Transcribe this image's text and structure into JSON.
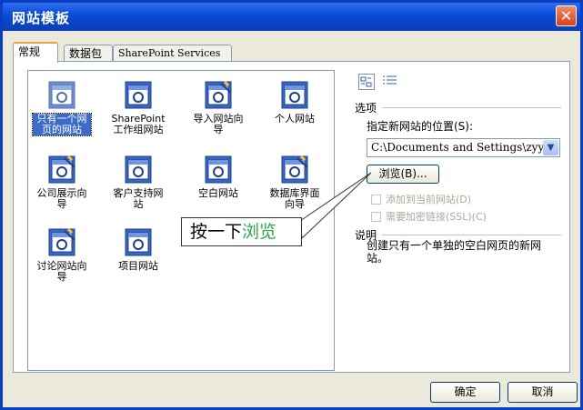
{
  "window": {
    "title": "网站模板",
    "close_glyph": "✕"
  },
  "tabs": [
    {
      "label": "常规",
      "active": true
    },
    {
      "label": "数据包",
      "active": false
    },
    {
      "label": "SharePoint Services",
      "active": false
    }
  ],
  "templates": [
    {
      "label": "只有一个网页的网站",
      "icon": "single-page-icon",
      "selected": true
    },
    {
      "label": "SharePoint 工作组网站",
      "icon": "page-icon",
      "selected": false
    },
    {
      "label": "导入网站向导",
      "icon": "wizard-icon",
      "selected": false
    },
    {
      "label": "个人网站",
      "icon": "page-icon",
      "selected": false
    },
    {
      "label": "公司展示向导",
      "icon": "wizard-icon",
      "selected": false
    },
    {
      "label": "客户支持网站",
      "icon": "page-icon",
      "selected": false
    },
    {
      "label": "空白网站",
      "icon": "page-icon",
      "selected": false
    },
    {
      "label": "数据库界面向导",
      "icon": "wizard-icon",
      "selected": false
    },
    {
      "label": "讨论网站向导",
      "icon": "wizard-icon",
      "selected": false
    },
    {
      "label": "项目网站",
      "icon": "page-icon",
      "selected": false
    }
  ],
  "options": {
    "heading": "选项",
    "location_label": "指定新网站的位置(S):",
    "location_value": "C:\\Documents and Settings\\zyy",
    "browse_label": "浏览(B)...",
    "add_current_label": "添加到当前网站(D)",
    "ssl_label": "需要加密链接(SSL)(C)"
  },
  "description": {
    "heading": "说明",
    "text": "创建只有一个单独的空白网页的新网站。"
  },
  "callout": {
    "prefix": "按一下",
    "keyword": "浏览"
  },
  "buttons": {
    "ok": "确定",
    "cancel": "取消"
  },
  "colors": {
    "titlebar": "#0b4ad6",
    "selection": "#3d6cc8",
    "callout_keyword": "#2aa84a"
  }
}
